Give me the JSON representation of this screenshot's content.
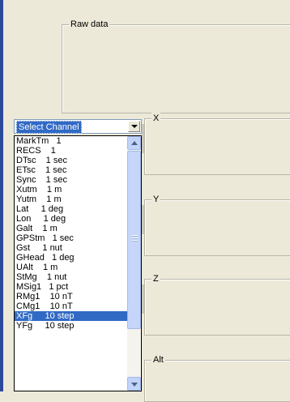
{
  "raw_data": {
    "label": "Raw data"
  },
  "channel_select": {
    "value": "Select Channel"
  },
  "channel_list": {
    "items": [
      "MarkTm   1",
      "RECS    1",
      "DTsc    1 sec",
      "ETsc    1 sec",
      "Sync    1 sec",
      "Xutm    1 m",
      "Yutm    1 m",
      "Lat     1 deg",
      "Lon     1 deg",
      "Galt    1 m",
      "GPStm   1 sec",
      "Gst     1 nut",
      "GHead   1 deg",
      "UAlt    1 m",
      "StMg    1 nut",
      "MSig1   1 pct",
      "RMg1    10 nT",
      "CMg1    10 nT",
      "XFg     10 step",
      "YFg     10 step"
    ],
    "selected": "XFg     10 step"
  },
  "plots": {
    "x_label": "X",
    "y_label": "Y",
    "z_label": "Z",
    "alt_label": "Alt"
  },
  "colors": {
    "selection": "#316ac5",
    "window_bg": "#ece9d8",
    "left_stripe": "#2c4a9a"
  }
}
